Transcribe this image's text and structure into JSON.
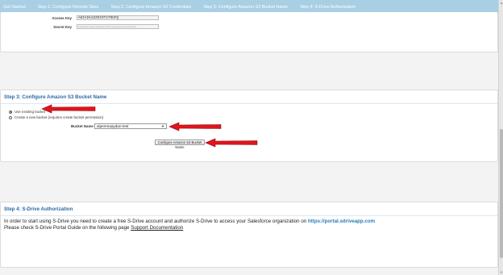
{
  "nav": {
    "tabs": [
      "Get Started",
      "Step 1: Configure Remote Sites",
      "Step 2: Configure Amazon S3 Credentials",
      "Step 3: Configure Amazon S3 Bucket Name",
      "Step 4: S-Drive Authorization"
    ]
  },
  "step2": {
    "access_key_label": "Access Key",
    "access_key_value": "AKIAIK4ZZKIOT27RGFQ",
    "secret_key_label": "Secret Key",
    "secret_key_value": "••••••••••••••••••••••••••••••••••••••••"
  },
  "step3": {
    "title": "Step 3: Configure Amazon S3 Bucket Name",
    "use_existing_label": "Use existing bucket",
    "create_new_label": "Create a new bucket (requires create bucket permission)",
    "bucket_name_label": "Bucket Name",
    "bucket_name_value": "alperenaaydan-test",
    "configure_button_label": "Configure Amazon S3 Bucket Name"
  },
  "step4": {
    "title": "Step 4: S-Drive Authorization",
    "line1_prefix": "In order to start using S-Drive you need to create a free S-Drive account and authorize S-Drive to access your Salesforce organization on ",
    "line1_link": "https://portal.sdriveapp.com",
    "line2_prefix": "Please check S-Drive Portal Guide on the following page ",
    "line2_link": "Support Documentation"
  },
  "colors": {
    "nav_bg": "#a8cfe3",
    "section_title": "#2a69a5",
    "link": "#2a7ab8",
    "annotation_arrow": "#e0141c"
  }
}
